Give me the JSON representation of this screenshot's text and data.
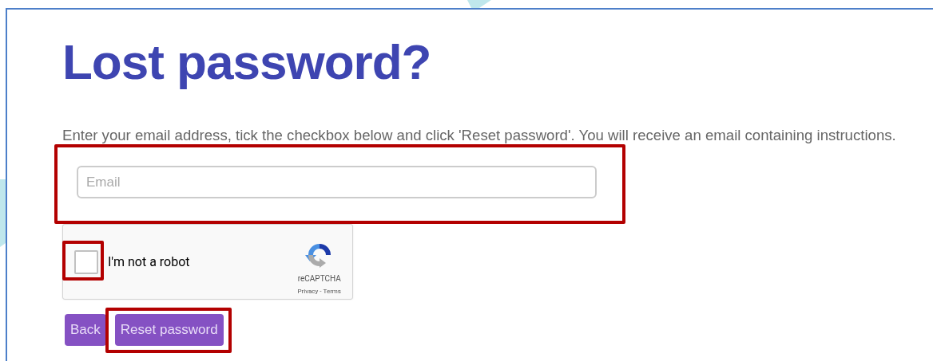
{
  "title": "Lost password?",
  "instructions": "Enter your email address, tick the checkbox below and click 'Reset password'. You will receive an email containing instructions.",
  "email_field": {
    "placeholder": "Email",
    "highlighted": true
  },
  "captcha": {
    "label": "I'm not a robot",
    "checked": false,
    "highlighted": true,
    "brand": "reCAPTCHA",
    "privacy": "Privacy",
    "separator": "-",
    "terms": "Terms"
  },
  "buttons": [
    {
      "label": "Back",
      "highlighted": false
    },
    {
      "label": "Reset password",
      "highlighted": true
    }
  ]
}
